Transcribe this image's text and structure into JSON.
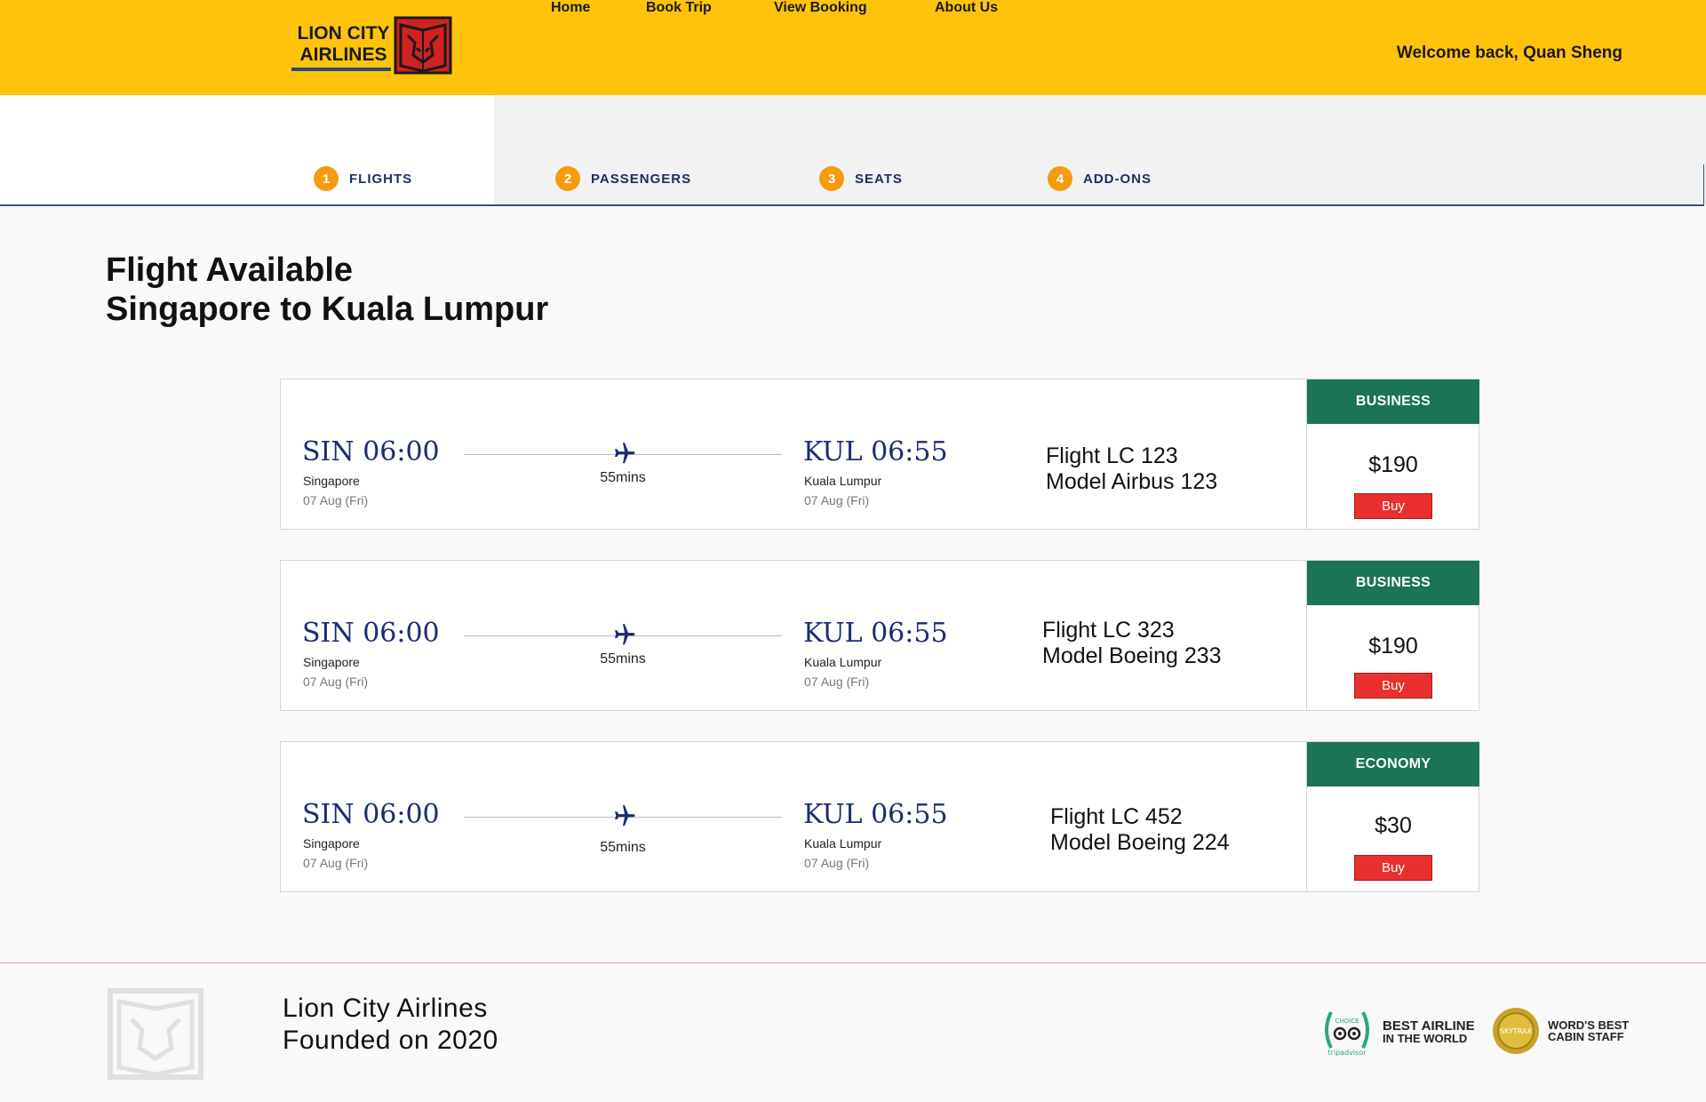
{
  "header": {
    "logo_line1": "LION CITY",
    "logo_line2": "AIRLINES",
    "nav": [
      "Home",
      "Book Trip",
      "View Booking",
      "About Us"
    ],
    "welcome": "Welcome back, Quan Sheng",
    "colors": {
      "background": "#ffc30b",
      "logo_red": "#d0221f"
    }
  },
  "steps": [
    {
      "num": "1",
      "label": "FLIGHTS",
      "active": true
    },
    {
      "num": "2",
      "label": "PASSENGERS"
    },
    {
      "num": "3",
      "label": "SEATS"
    },
    {
      "num": "4",
      "label": "ADD-ONS"
    }
  ],
  "main": {
    "title_line1": "Flight Available",
    "title_line2": "Singapore to Kuala Lumpur"
  },
  "flights": [
    {
      "dep_time": "SIN 06:00",
      "dep_city": "Singapore",
      "dep_date": "07 Aug (Fri)",
      "duration": "55mins",
      "arr_time": "KUL 06:55",
      "arr_city": "Kuala Lumpur",
      "arr_date": "07 Aug (Fri)",
      "flight": "Flight LC 123",
      "model": "Model Airbus 123",
      "class": "BUSINESS",
      "price": "$190",
      "buy": "Buy"
    },
    {
      "dep_time": "SIN 06:00",
      "dep_city": "Singapore",
      "dep_date": "07 Aug (Fri)",
      "duration": "55mins",
      "arr_time": "KUL 06:55",
      "arr_city": "Kuala Lumpur",
      "arr_date": "07 Aug (Fri)",
      "flight": "Flight LC 323",
      "model": "Model Boeing 233",
      "class": "BUSINESS",
      "price": "$190",
      "buy": "Buy"
    },
    {
      "dep_time": "SIN 06:00",
      "dep_city": "Singapore",
      "dep_date": "07 Aug (Fri)",
      "duration": "55mins",
      "arr_time": "KUL 06:55",
      "arr_city": "Kuala Lumpur",
      "arr_date": "07 Aug (Fri)",
      "flight": "Flight LC 452",
      "model": "Model Boeing 224",
      "class": "ECONOMY",
      "price": "$30",
      "buy": "Buy"
    }
  ],
  "footer": {
    "line1": "Lion City Airlines",
    "line2": "Founded on 2020",
    "award1_line1": "BEST AIRLINE",
    "award1_line2": "IN THE WORLD",
    "award2_line1": "WORD'S BEST",
    "award2_line2": "CABIN STAFF",
    "award1_badge": "tripadvisor",
    "award2_badge": "SKYTRAX"
  },
  "icons": {
    "logo": "lion-book-emblem",
    "plane": "airplane-icon",
    "award1": "tripadvisor-laurel-icon",
    "award2": "gold-medal-icon"
  }
}
